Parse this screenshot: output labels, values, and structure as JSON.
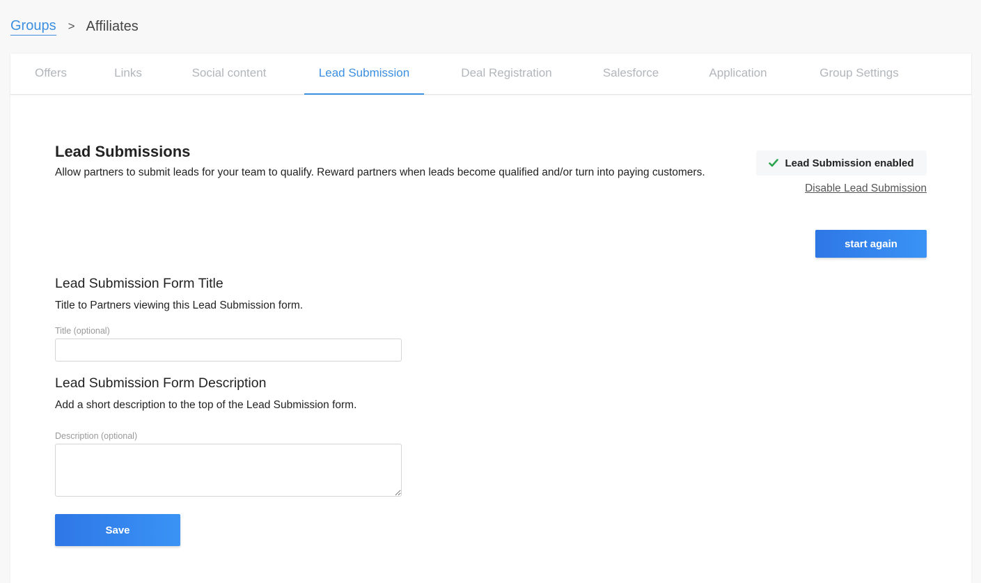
{
  "breadcrumb": {
    "parent": "Groups",
    "separator": ">",
    "current": "Affiliates"
  },
  "tabs": [
    {
      "label": "Offers",
      "active": false
    },
    {
      "label": "Links",
      "active": false
    },
    {
      "label": "Social content",
      "active": false
    },
    {
      "label": "Lead Submission",
      "active": true
    },
    {
      "label": "Deal Registration",
      "active": false
    },
    {
      "label": "Salesforce",
      "active": false
    },
    {
      "label": "Application",
      "active": false
    },
    {
      "label": "Group Settings",
      "active": false
    }
  ],
  "section": {
    "title": "Lead Submissions",
    "description": "Allow partners to submit leads for your team to qualify. Reward partners when leads become qualified and/or turn into paying customers."
  },
  "status": {
    "label": "Lead Submission enabled",
    "icon": "check-icon",
    "icon_color": "#2ea44f",
    "disable_link": "Disable Lead Submission"
  },
  "start_again_label": "start again",
  "form": {
    "title_heading": "Lead Submission Form Title",
    "title_help": "Title to Partners viewing this Lead Submission form.",
    "title_label": "Title (optional)",
    "title_value": "",
    "description_heading": "Lead Submission Form Description",
    "description_help": "Add a short description to the top of the Lead Submission form.",
    "description_label": "Description (optional)",
    "description_value": "",
    "save_label": "Save"
  },
  "colors": {
    "accent": "#3b8fe0",
    "button_start": "#2e77e6",
    "button_end": "#3a93f5",
    "tab_inactive": "#b2b6bb"
  }
}
